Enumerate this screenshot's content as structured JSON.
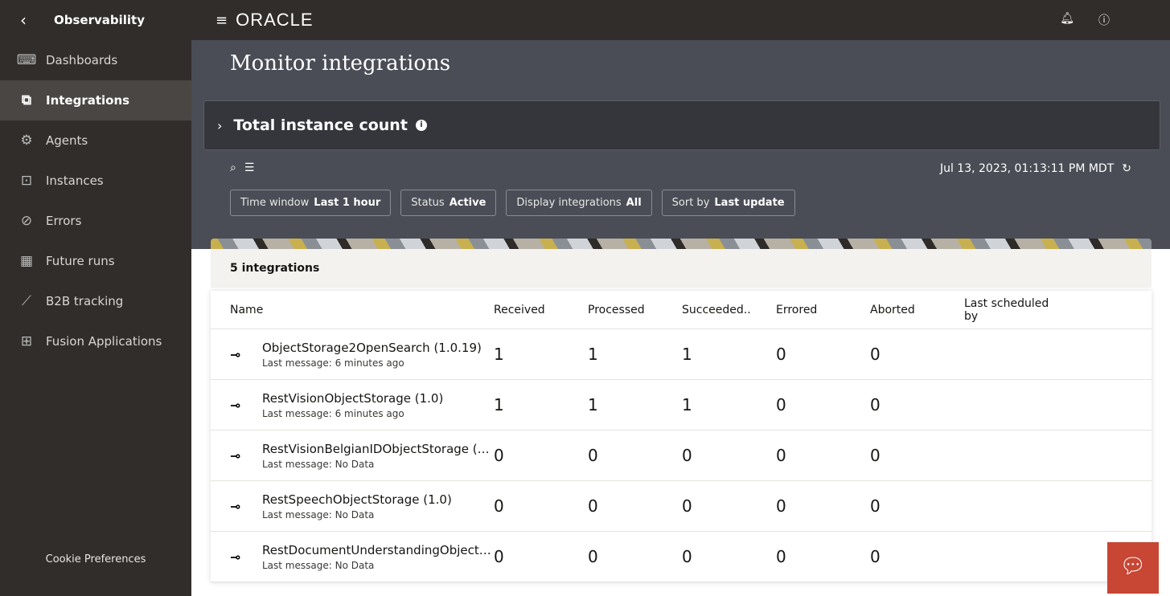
{
  "app": {
    "title": "Observability",
    "logo": "ORACLE"
  },
  "sidebar": {
    "items": [
      {
        "label": "Dashboards",
        "icon": "monitor-icon",
        "glyph": "⌨"
      },
      {
        "label": "Integrations",
        "icon": "integrations-icon",
        "glyph": "⧉",
        "active": true
      },
      {
        "label": "Agents",
        "icon": "gear-icon",
        "glyph": "⚙"
      },
      {
        "label": "Instances",
        "icon": "inbox-icon",
        "glyph": "⊡"
      },
      {
        "label": "Errors",
        "icon": "prohibited-icon",
        "glyph": "⊘"
      },
      {
        "label": "Future runs",
        "icon": "calendar-icon",
        "glyph": "▦"
      },
      {
        "label": "B2B tracking",
        "icon": "chart-icon",
        "glyph": "⟋"
      },
      {
        "label": "Fusion Applications",
        "icon": "apps-icon",
        "glyph": "⊞"
      }
    ],
    "cookie": "Cookie Preferences"
  },
  "page": {
    "title": "Monitor integrations",
    "panel_title": "Total instance count",
    "timestamp": "Jul 13, 2023, 01:13:11 PM MDT"
  },
  "filters": [
    {
      "label": "Time window",
      "value": "Last 1 hour"
    },
    {
      "label": "Status",
      "value": "Active"
    },
    {
      "label": "Display integrations",
      "value": "All"
    },
    {
      "label": "Sort by",
      "value": "Last update"
    }
  ],
  "table": {
    "count": "5 integrations",
    "columns": [
      "Name",
      "Received",
      "Processed",
      "Succeeded..",
      "Errored",
      "Aborted",
      "Last scheduled by"
    ],
    "rows": [
      {
        "name": "ObjectStorage2OpenSearch (1.0.19)",
        "sub": "Last message: 6 minutes ago",
        "vals": [
          "1",
          "1",
          "1",
          "0",
          "0"
        ]
      },
      {
        "name": "RestVisionObjectStorage (1.0)",
        "sub": "Last message: 6 minutes ago",
        "vals": [
          "1",
          "1",
          "1",
          "0",
          "0"
        ]
      },
      {
        "name": "RestVisionBelgianIDObjectStorage (…",
        "sub": "Last message: No Data",
        "vals": [
          "0",
          "0",
          "0",
          "0",
          "0"
        ]
      },
      {
        "name": "RestSpeechObjectStorage (1.0)",
        "sub": "Last message: No Data",
        "vals": [
          "0",
          "0",
          "0",
          "0",
          "0"
        ]
      },
      {
        "name": "RestDocumentUnderstandingObject…",
        "sub": "Last message: No Data",
        "vals": [
          "0",
          "0",
          "0",
          "0",
          "0"
        ]
      }
    ]
  },
  "colors": {
    "sidebar": "#312d2a",
    "header": "#4a4d55",
    "accent": "#c74634"
  }
}
